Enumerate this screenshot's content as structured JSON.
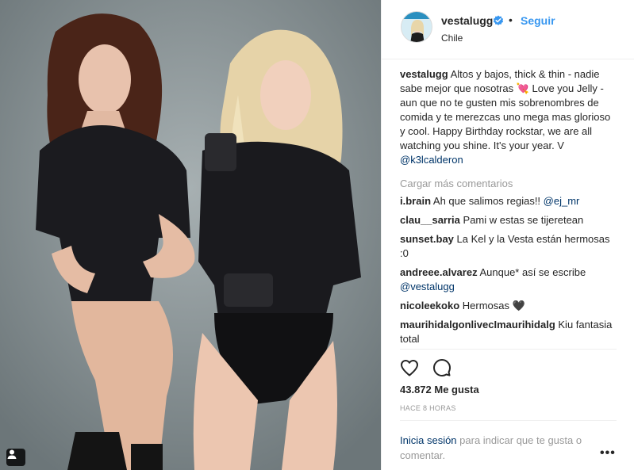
{
  "post": {
    "photo_description_icon": "tag-people-icon"
  },
  "header": {
    "username": "vestalugg",
    "verified_icon": "verified-badge-icon",
    "separator": "•",
    "follow_label": "Seguir",
    "location": "Chile"
  },
  "caption": {
    "username": "vestalugg",
    "text": "Altos y bajos, thick & thin - nadie sabe mejor que nosotras 💘 Love you Jelly - aun que no te gusten mis sobrenombres de comida y te merezcas uno mega mas glorioso y cool. Happy Birthday rockstar, we are all watching you shine. It's your year. V ",
    "mention": "@k3lcalderon"
  },
  "load_more": "Cargar más comentarios",
  "comments": [
    {
      "username": "i.brain",
      "text": "Ah que salimos regias!! ",
      "mention": "@ej_mr"
    },
    {
      "username": "clau__sarria",
      "text": "Pami w estas se tijeretean",
      "mention": ""
    },
    {
      "username": "sunset.bay",
      "text": "La Kel y la Vesta están hermosas :0",
      "mention": ""
    },
    {
      "username": "andreee.alvarez",
      "text": "Aunque* así se escribe ",
      "mention": "@vestalugg"
    },
    {
      "username": "nicoleekoko",
      "text": "Hermosas 🖤",
      "mention": ""
    },
    {
      "username": "maurihidalgonlivecImaurihidalg",
      "text": "Kiu fantasia total",
      "mention": ""
    }
  ],
  "actions": {
    "like_icon": "heart-icon",
    "comment_icon": "comment-icon"
  },
  "likes": "43.872 Me gusta",
  "timestamp": "HACE 8 HORAS",
  "login_prompt": {
    "link": "Inicia sesión",
    "text": " para indicar que te gusta o comentar."
  },
  "more_options": "•••",
  "colors": {
    "link_blue": "#3897f0",
    "mention_blue": "#003569",
    "muted_gray": "#999999",
    "text": "#262626"
  }
}
